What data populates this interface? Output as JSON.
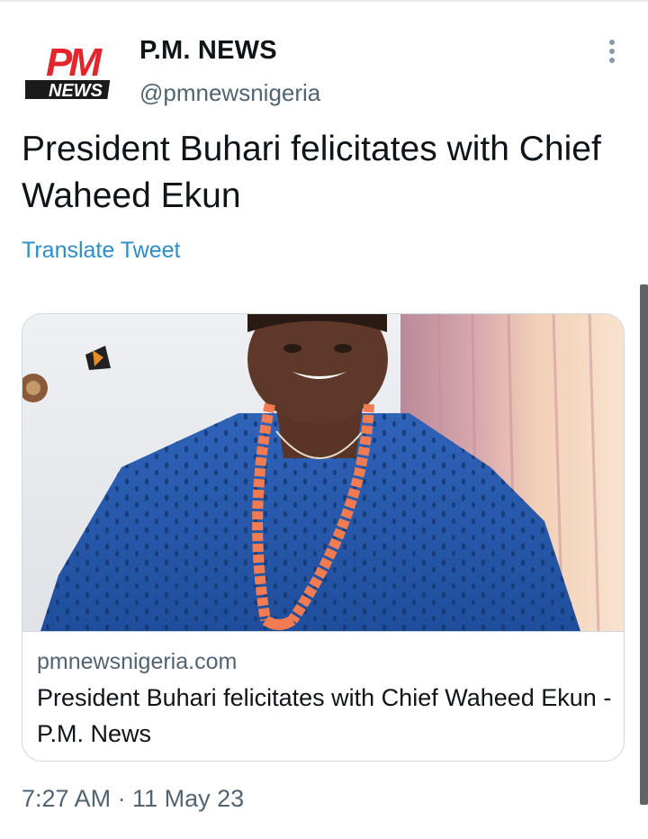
{
  "account": {
    "name": "P.M. NEWS",
    "handle": "@pmnewsnigeria",
    "logo_top": "PM",
    "logo_bottom": "NEWS"
  },
  "tweet": {
    "text": "President Buhari felicitates with Chief Waheed Ekun",
    "translate_label": "Translate Tweet",
    "timestamp": "7:27 AM · 11 May 23"
  },
  "card": {
    "domain": "pmnewsnigeria.com",
    "title": "President Buhari felicitates with Chief Waheed Ekun - P.M. News"
  },
  "icons": {
    "more": "more-vertical-icon"
  },
  "colors": {
    "link": "#2b8ec7",
    "secondary_text": "#536471",
    "logo_red": "#e3262b",
    "logo_dark": "#1a1a1a"
  }
}
